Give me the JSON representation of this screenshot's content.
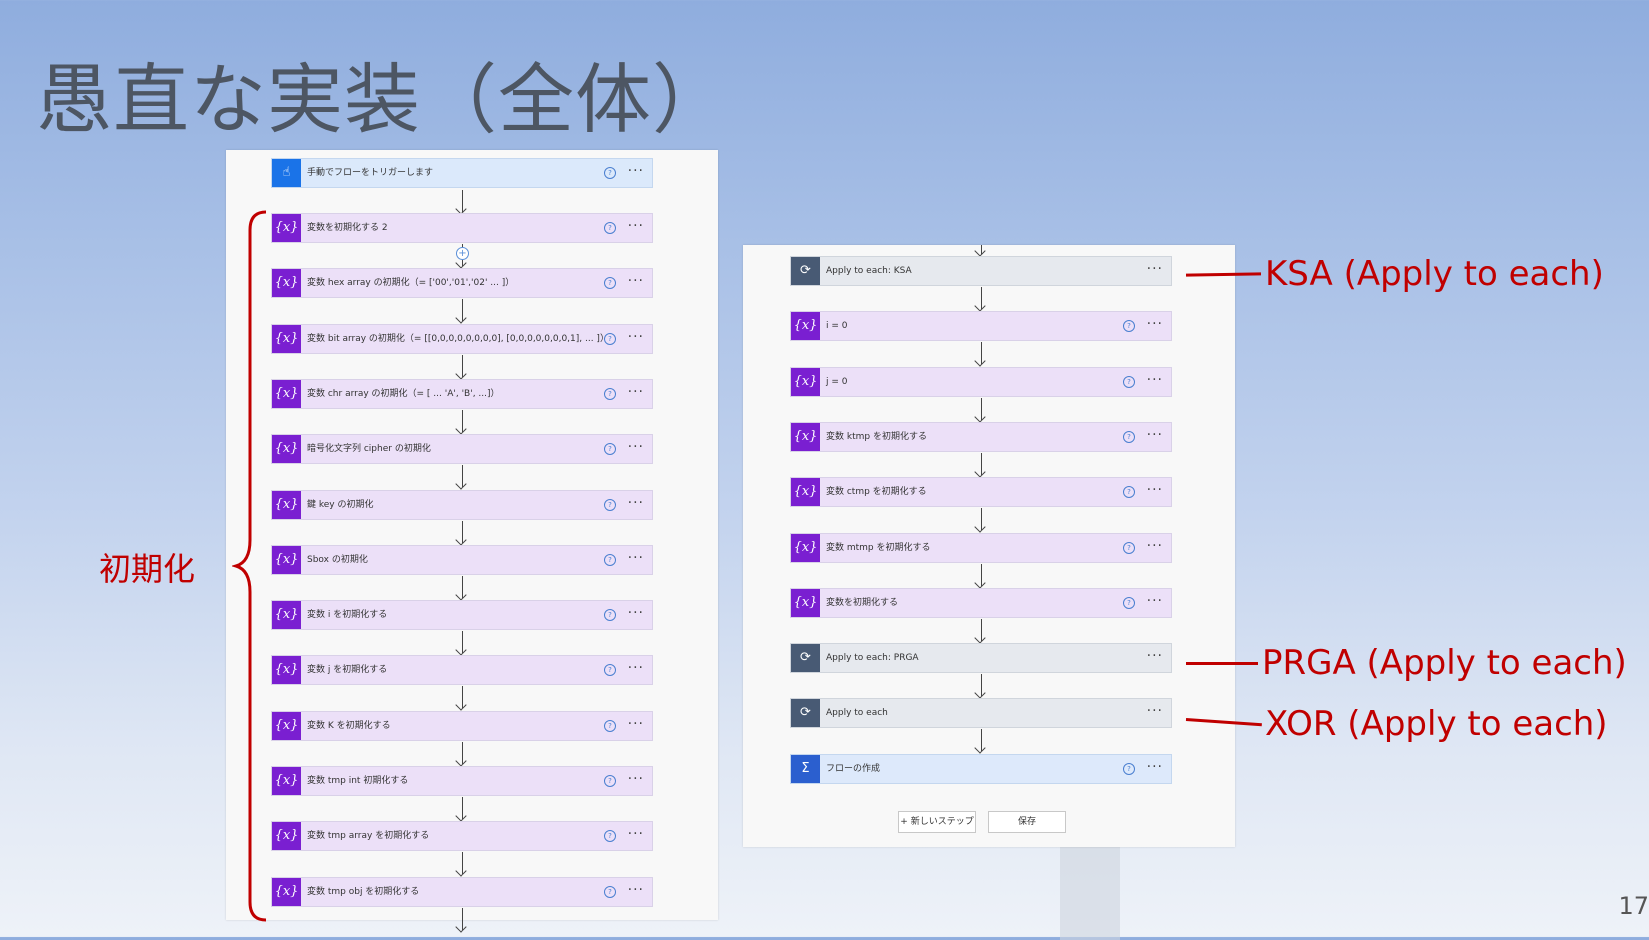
{
  "slide": {
    "title": "愚直な実装（全体）",
    "page_number": "17"
  },
  "annotations": {
    "init": "初期化",
    "ksa": "KSA (Apply to each)",
    "prga": "PRGA (Apply to each)",
    "xor": "XOR (Apply to each)"
  },
  "left_flow": {
    "trigger": {
      "label": "手動でフローをトリガーします",
      "icon": "hand-tap-icon"
    },
    "steps": [
      {
        "label": "変数を初期化する 2"
      },
      {
        "label": "変数 hex array の初期化（= ['00','01','02' ... ]）"
      },
      {
        "label": "変数 bit array の初期化（= [[0,0,0,0,0,0,0,0], [0,0,0,0,0,0,0,1], ... ]）"
      },
      {
        "label": "変数 chr array の初期化（= [ ... 'A', 'B', ...]）"
      },
      {
        "label": "暗号化文字列 cipher の初期化"
      },
      {
        "label": "鍵 key の初期化"
      },
      {
        "label": "Sbox の初期化"
      },
      {
        "label": "変数 i を初期化する"
      },
      {
        "label": "変数 j を初期化する"
      },
      {
        "label": "変数 K を初期化する"
      },
      {
        "label": "変数 tmp int 初期化する"
      },
      {
        "label": "変数 tmp array を初期化する"
      },
      {
        "label": "変数 tmp obj を初期化する"
      }
    ]
  },
  "right_flow": {
    "steps": [
      {
        "label": "Apply to each: KSA",
        "type": "loop"
      },
      {
        "label": "i = 0",
        "type": "var"
      },
      {
        "label": "j = 0",
        "type": "var"
      },
      {
        "label": "変数 ktmp を初期化する",
        "type": "var"
      },
      {
        "label": "変数 ctmp を初期化する",
        "type": "var"
      },
      {
        "label": "変数 mtmp を初期化する",
        "type": "var"
      },
      {
        "label": "変数を初期化する",
        "type": "var"
      },
      {
        "label": "Apply to each: PRGA",
        "type": "loop"
      },
      {
        "label": "Apply to each",
        "type": "loop"
      },
      {
        "label": "フローの作成",
        "type": "compose"
      }
    ],
    "new_step_button": "+ 新しいステップ",
    "save_button": "保存"
  },
  "icons": {
    "variable": "{x}",
    "loop": "⟳",
    "help": "?",
    "more": "···"
  },
  "colors": {
    "annotation": "#c00000",
    "variable_card": "#ece0f8",
    "variable_icon": "#7a1fd1"
  }
}
